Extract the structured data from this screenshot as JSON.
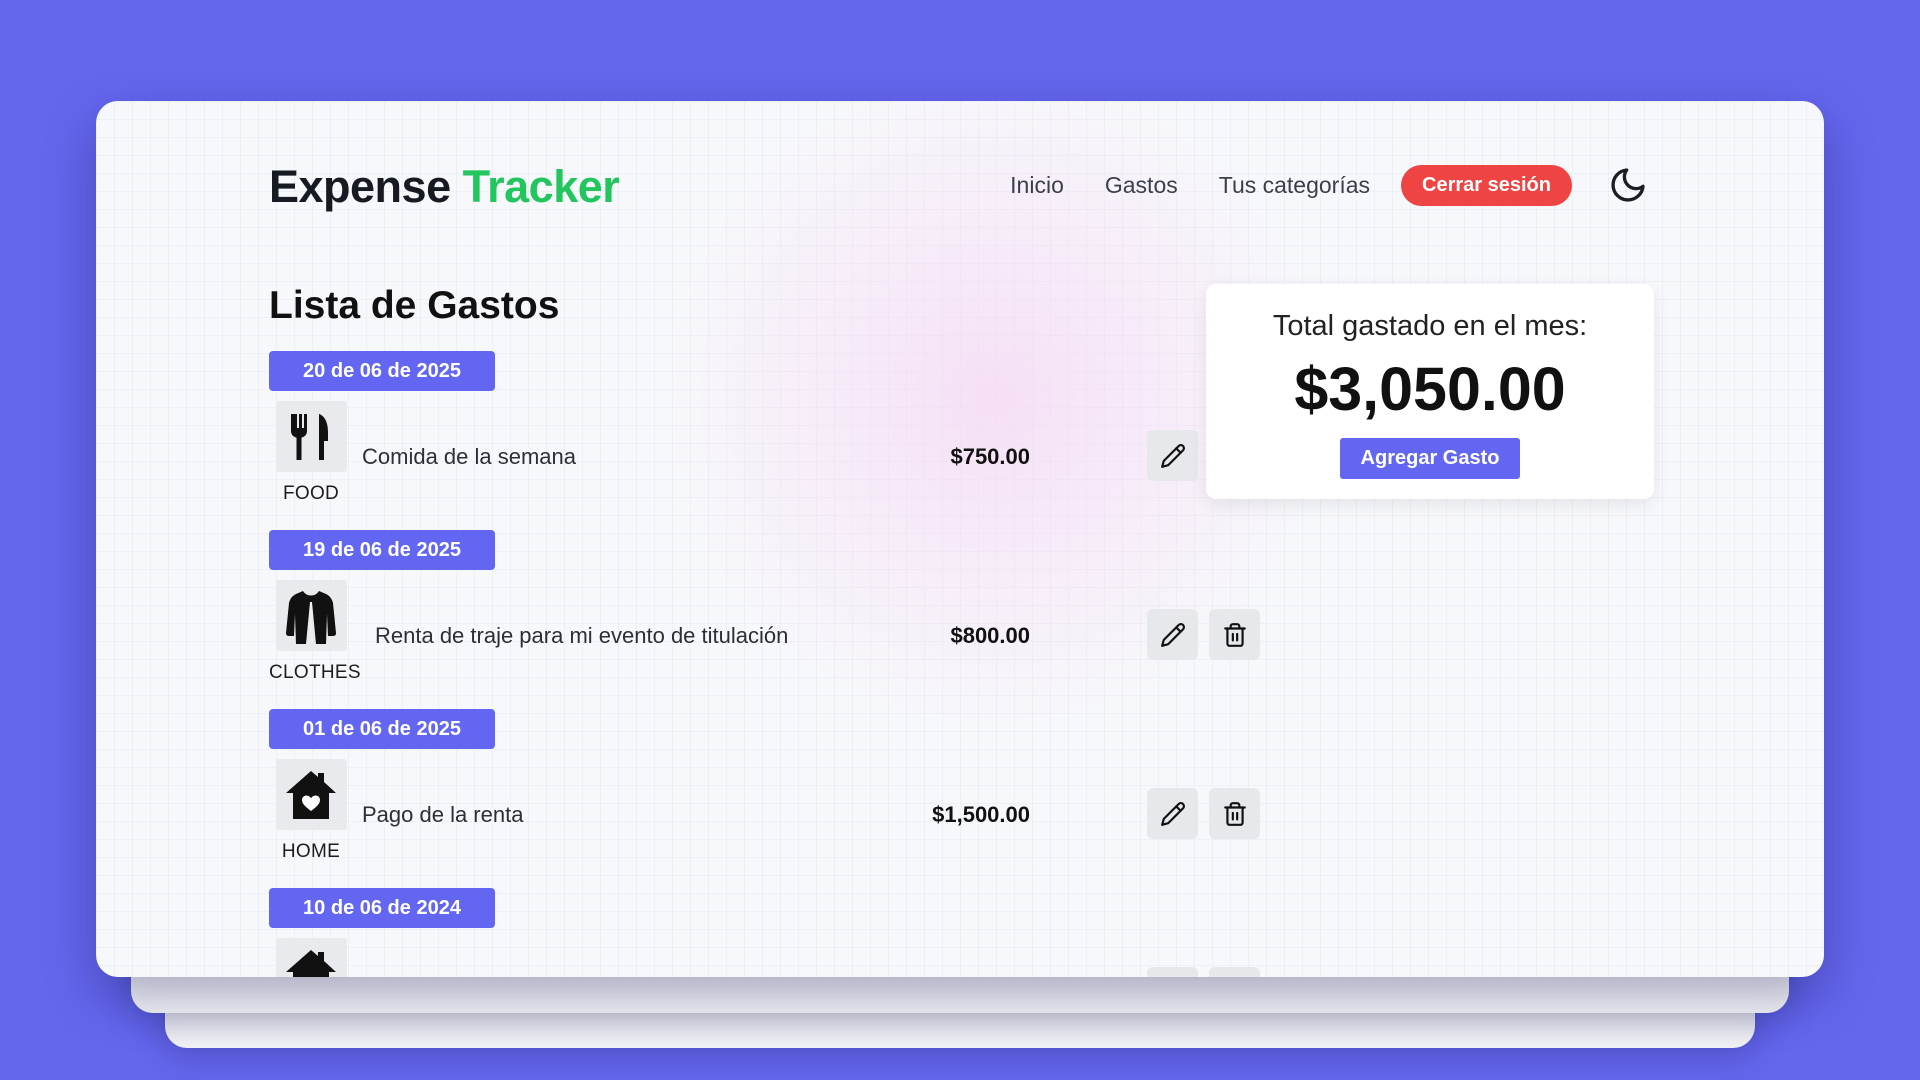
{
  "brand": {
    "part1": "Expense",
    "part2": "Tracker",
    "accent_color": "#22c55e"
  },
  "nav": {
    "links": [
      "Inicio",
      "Gastos",
      "Tus categorías"
    ],
    "logout_label": "Cerrar sesión",
    "logout_color": "#ef4444",
    "theme_icon": "moon-icon"
  },
  "list": {
    "title": "Lista de Gastos",
    "badge_color": "#6366f1",
    "groups": [
      {
        "date": "20 de 06 de 2025",
        "category": "FOOD",
        "category_icon": "fork-knife-icon",
        "description": "Comida de la semana",
        "amount": "$750.00"
      },
      {
        "date": "19 de 06 de 2025",
        "category": "CLOTHES",
        "category_icon": "jacket-icon",
        "description": "Renta de traje para mi evento de titulación",
        "amount": "$800.00"
      },
      {
        "date": "01 de 06 de 2025",
        "category": "HOME",
        "category_icon": "house-heart-icon",
        "description": "Pago de la renta",
        "amount": "$1,500.00"
      },
      {
        "date": "10 de 06 de 2024",
        "category_icon": "house-icon"
      }
    ]
  },
  "summary": {
    "label": "Total gastado en el mes:",
    "total": "$3,050.00",
    "add_button_label": "Agregar Gasto"
  }
}
